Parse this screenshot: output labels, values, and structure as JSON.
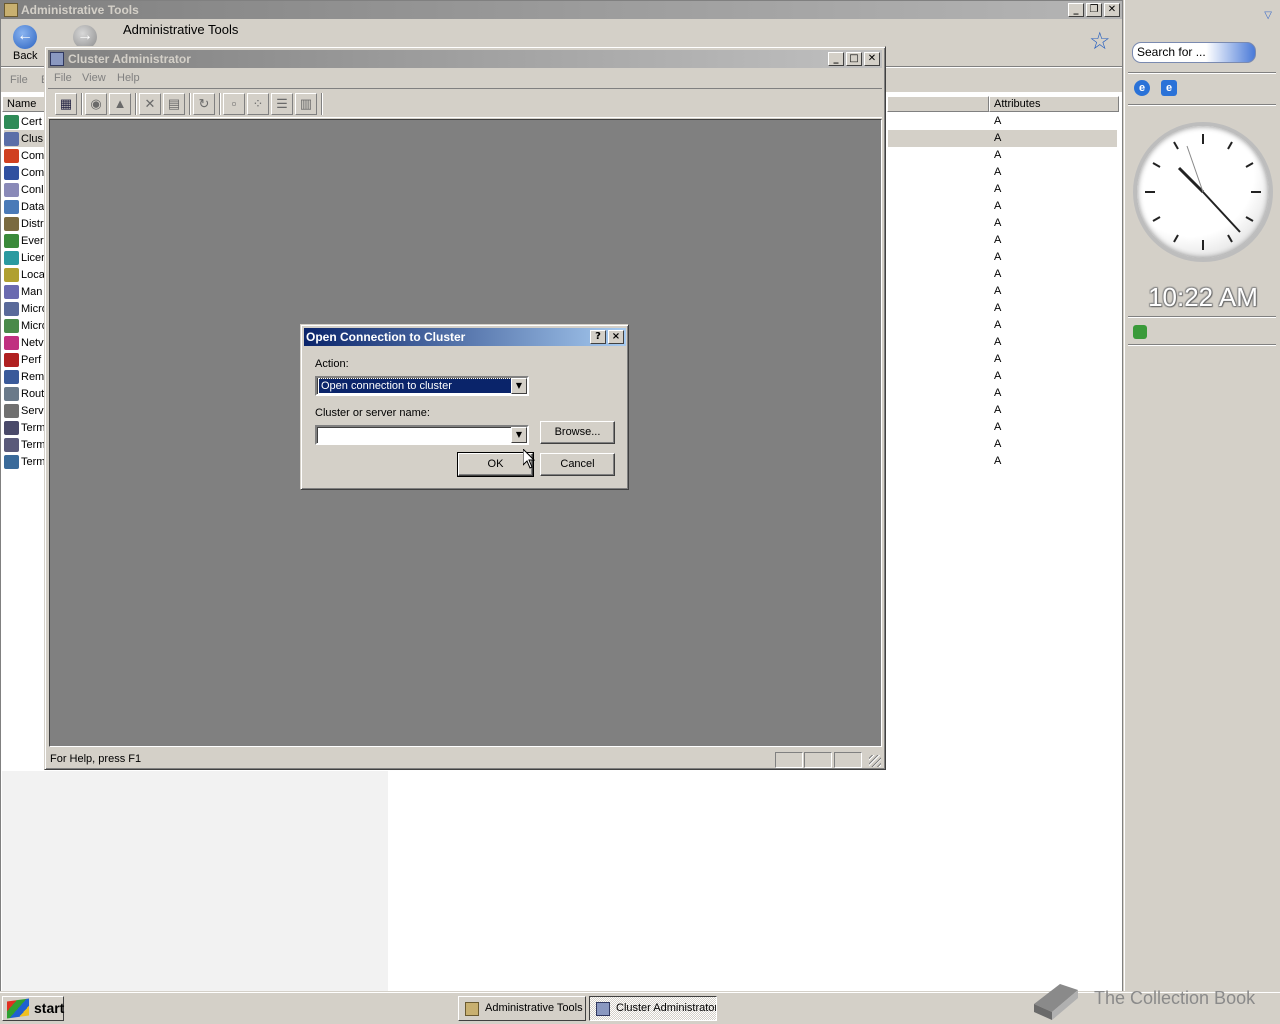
{
  "explorer": {
    "title": "Administrative Tools",
    "back_label": "Back",
    "address_title": "Administrative Tools",
    "menu": [
      "File",
      "E"
    ],
    "col_name": "Name",
    "col_attributes": "Attributes",
    "items": [
      {
        "label": "Cert",
        "attr": "A",
        "color": "#2e8b57"
      },
      {
        "label": "Clus",
        "attr": "A",
        "color": "#5a6ea8",
        "selected": true
      },
      {
        "label": "Com",
        "attr": "A",
        "color": "#d04020"
      },
      {
        "label": "Com",
        "attr": "A",
        "color": "#3050a0"
      },
      {
        "label": "Conl",
        "attr": "A",
        "color": "#8a8ab8"
      },
      {
        "label": "Data",
        "attr": "A",
        "color": "#4a7ab8"
      },
      {
        "label": "Distr",
        "attr": "A",
        "color": "#7a6a40"
      },
      {
        "label": "Ever",
        "attr": "A",
        "color": "#3a8a3a"
      },
      {
        "label": "Licer",
        "attr": "A",
        "color": "#2a9aa0"
      },
      {
        "label": "Loca",
        "attr": "A",
        "color": "#b0a030"
      },
      {
        "label": "Man",
        "attr": "A",
        "color": "#6a6ab0"
      },
      {
        "label": "Micro",
        "attr": "A",
        "color": "#5a6a9a"
      },
      {
        "label": "Micro",
        "attr": "A",
        "color": "#4a8a4a"
      },
      {
        "label": "Netv",
        "attr": "A",
        "color": "#c03080"
      },
      {
        "label": "Perf",
        "attr": "A",
        "color": "#b02020"
      },
      {
        "label": "Rem",
        "attr": "A",
        "color": "#3a5a9a"
      },
      {
        "label": "Rout",
        "attr": "A",
        "color": "#6a7a8a"
      },
      {
        "label": "Serv",
        "attr": "A",
        "color": "#707070"
      },
      {
        "label": "Term",
        "attr": "A",
        "color": "#4a4a6a"
      },
      {
        "label": "Term",
        "attr": "A",
        "color": "#5a5a7a"
      },
      {
        "label": "Term",
        "attr": "A",
        "color": "#3a6a9a"
      }
    ]
  },
  "sidebar": {
    "search_text": "Search for ...",
    "time": "10:22 AM"
  },
  "cluadmin": {
    "title": "Cluster Administrator",
    "menu": [
      "File",
      "View",
      "Help"
    ],
    "status_text": "For Help, press F1"
  },
  "dialog": {
    "title": "Open Connection to Cluster",
    "help_btn": "?",
    "close_btn": "×",
    "action_label": "Action:",
    "action_value": "Open connection to cluster",
    "server_label": "Cluster or server name:",
    "server_value": "",
    "browse_label": "Browse...",
    "ok_label": "OK",
    "cancel_label": "Cancel"
  },
  "taskbar": {
    "start_label": "start",
    "tasks": [
      "Administrative Tools",
      "Cluster Administrator"
    ]
  },
  "watermark": {
    "text": "The Collection Book"
  }
}
